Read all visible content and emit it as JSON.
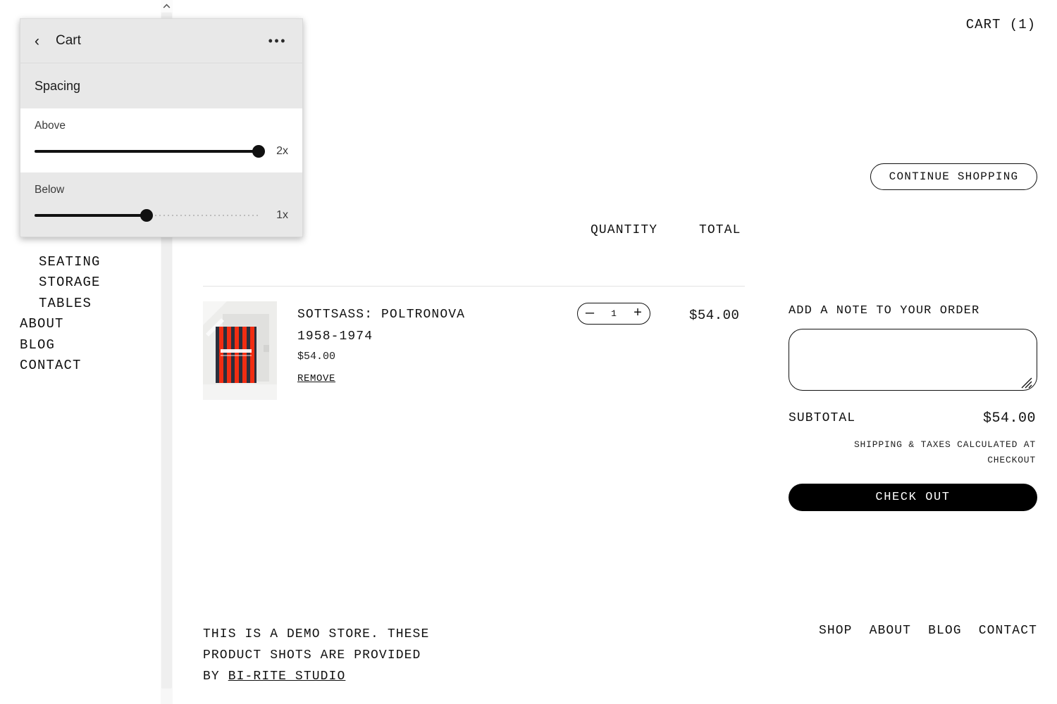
{
  "store": {
    "cart_count_label": "CART (1)",
    "continue_shopping_label": "CONTINUE SHOPPING",
    "nav": [
      {
        "label": "SEATING",
        "indent": true
      },
      {
        "label": "STORAGE",
        "indent": true
      },
      {
        "label": "TABLES",
        "indent": true
      },
      {
        "label": "ABOUT",
        "indent": false
      },
      {
        "label": "BLOG",
        "indent": false
      },
      {
        "label": "CONTACT",
        "indent": false
      }
    ],
    "table": {
      "col_quantity": "QUANTITY",
      "col_total": "TOTAL"
    },
    "line_item": {
      "title_line1": "SOTTSASS: POLTRONOVA",
      "title_line2": "1958-1974",
      "unit_price": "$54.00",
      "remove_label": "REMOVE",
      "quantity": "1",
      "decrease_label": "—",
      "increase_label": "+",
      "line_total": "$54.00"
    },
    "summary": {
      "note_label": "ADD A NOTE TO YOUR ORDER",
      "note_value": "",
      "note_placeholder": "",
      "subtotal_label": "SUBTOTAL",
      "subtotal_value": "$54.00",
      "tax_note": "SHIPPING & TAXES CALCULATED AT CHECKOUT",
      "checkout_label": "CHECK OUT"
    },
    "footer": {
      "text_line1": "THIS IS A DEMO STORE. THESE",
      "text_line2": "PRODUCT SHOTS ARE PROVIDED",
      "text_line3_prefix": "BY ",
      "text_link": "BI-RITE STUDIO",
      "nav": [
        "SHOP",
        "ABOUT",
        "BLOG",
        "CONTACT"
      ]
    }
  },
  "editor": {
    "back_icon": "‹",
    "title": "Cart",
    "more_icon": "•••",
    "section_title": "Spacing",
    "settings": [
      {
        "label": "Above",
        "value_label": "2x",
        "percent": 100
      },
      {
        "label": "Below",
        "value_label": "1x",
        "percent": 50
      }
    ]
  },
  "scrollbar": {
    "up_arrow_icon": "⌃"
  },
  "colors": {
    "accent": "#000000",
    "panel_bg": "#e8e8e8",
    "panel_row_bg": "#ffffff",
    "track_inactive": "#bdbdbd",
    "divider": "#e3e3e3"
  }
}
